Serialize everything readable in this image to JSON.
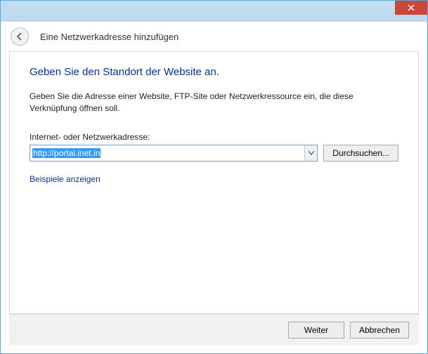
{
  "window": {
    "close_icon": "close"
  },
  "header": {
    "title": "Eine Netzwerkadresse hinzufügen",
    "back_icon": "back"
  },
  "main": {
    "heading": "Geben Sie den Standort der Website an.",
    "description": "Geben Sie die Adresse einer Website, FTP-Site oder Netzwerkressource ein, die diese Verknüpfung öffnen soll.",
    "field_label": "Internet- oder Netzwerkadresse:",
    "address_value": "http://portal.inet.in",
    "browse_label": "Durchsuchen...",
    "examples_link": "Beispiele anzeigen"
  },
  "footer": {
    "next_label": "Weiter",
    "cancel_label": "Abbrechen"
  }
}
